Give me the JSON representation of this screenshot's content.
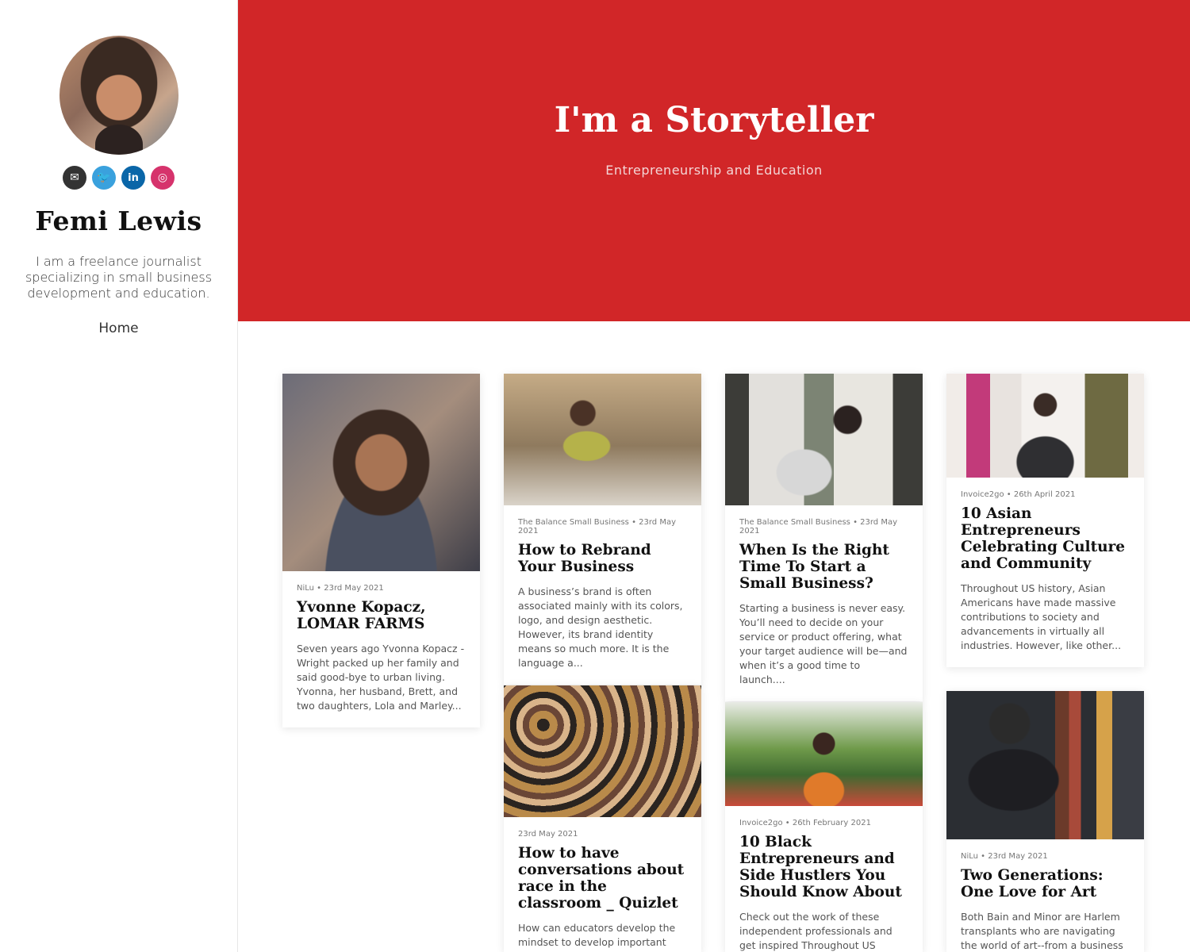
{
  "sidebar": {
    "name": "Femi Lewis",
    "bio": "I am a freelance journalist specializing in small business development and education.",
    "nav": [
      "Home"
    ],
    "socials": [
      {
        "icon": "mail-icon",
        "glyph": "✉"
      },
      {
        "icon": "twitter-icon",
        "glyph": "🐦"
      },
      {
        "icon": "linkedin-icon",
        "glyph": "in"
      },
      {
        "icon": "instagram-icon",
        "glyph": "◎"
      }
    ]
  },
  "hero": {
    "title": "I'm a Storyteller",
    "subtitle": "Entrepreneurship and Education",
    "color": "#d12628"
  },
  "posts": [
    {
      "meta": "NiLu • 23rd May 2021",
      "title": "Yvonne Kopacz, LOMAR FARMS",
      "excerpt": "Seven years ago Yvonna Kopacz - Wright packed up her family and said good-bye to urban living. Yvonna, her husband, Brett, and two daughters, Lola and Marley..."
    },
    {
      "meta": "The Balance Small Business • 23rd May 2021",
      "title": "How to Rebrand Your Business",
      "excerpt": "A business’s brand is often associated mainly with its colors, logo, and design aesthetic. However, its brand identity means so much more. It is the language a..."
    },
    {
      "meta": "The Balance Small Business • 23rd May 2021",
      "title": "When Is the Right Time To Start a Small Business?",
      "excerpt": "Starting a business is never easy. You’ll need to decide on your service or product offering, what your target audience will be—and when it’s a good time to launch...."
    },
    {
      "meta": "Invoice2go • 26th April 2021",
      "title": "10 Asian Entrepreneurs Celebrating Culture and Community",
      "excerpt": "Throughout US history, Asian Americans have made massive contributions to society and advancements in virtually all industries. However, like other..."
    },
    {
      "meta": "23rd May 2021",
      "title": "How to have conversations about race in the classroom _ Quizlet",
      "excerpt": "How can educators develop the mindset to develop important"
    },
    {
      "meta": "Invoice2go • 26th February 2021",
      "title": "10 Black Entrepreneurs and Side Hustlers You Should Know About",
      "excerpt": "Check out the work of these independent professionals and get inspired Throughout US history,"
    },
    {
      "meta": "NiLu • 23rd May 2021",
      "title": "Two Generations: One Love for Art",
      "excerpt": "Both Bain and Minor are Harlem transplants who are navigating the world of art--from a business and"
    }
  ]
}
